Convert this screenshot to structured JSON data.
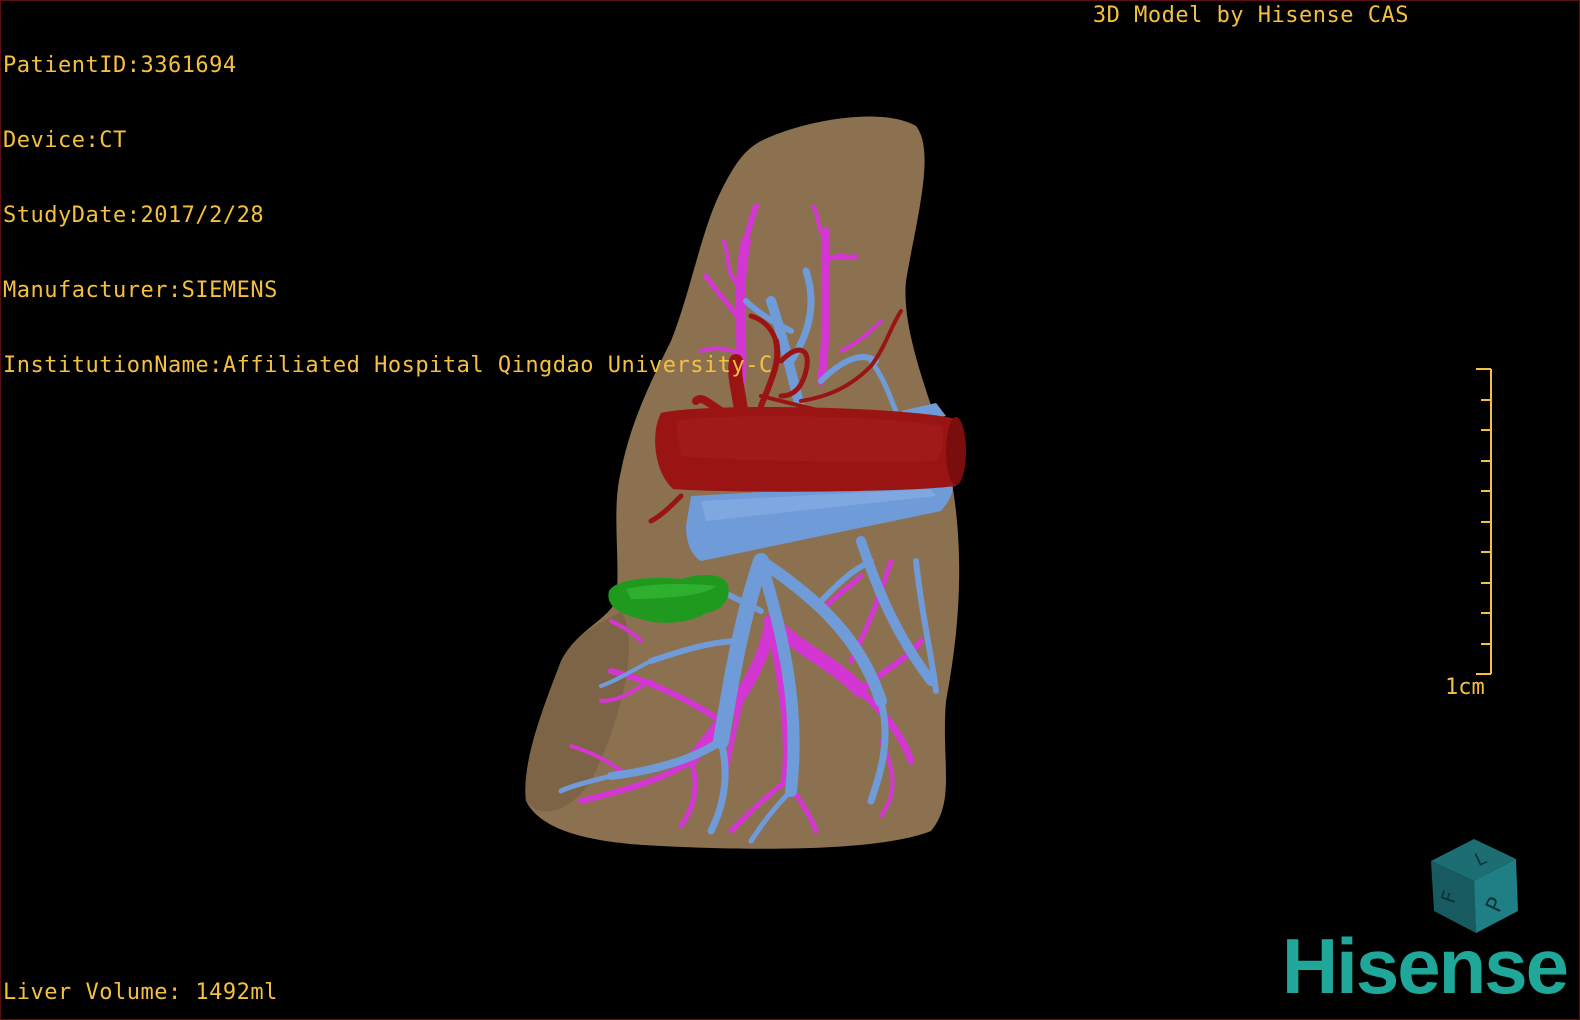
{
  "patient_info": {
    "patient_id": "PatientID:3361694",
    "device": "Device:CT",
    "study_date": "StudyDate:2017/2/28",
    "manufacturer": "Manufacturer:SIEMENS",
    "institution": "InstitutionName:Affiliated Hospital Qingdao University-C"
  },
  "credit": "3D Model by Hisense CAS",
  "liver_volume": "Liver Volume: 1492ml",
  "scale": {
    "label": "1cm"
  },
  "orientation_cube": {
    "face_front": "P",
    "face_left": "F",
    "face_top": "L"
  },
  "brand": "Hisense",
  "colors": {
    "text": "#f5c040",
    "liver": "#8b7150",
    "artery": "#9a1414",
    "portal_vein": "#6f9bd8",
    "hepatic_vein": "#d436d4",
    "tumor": "#1f9a1f",
    "brand": "#1fa89a"
  },
  "icons": {
    "orientation": "orientation-cube-icon",
    "scale": "ruler-scale-icon"
  }
}
